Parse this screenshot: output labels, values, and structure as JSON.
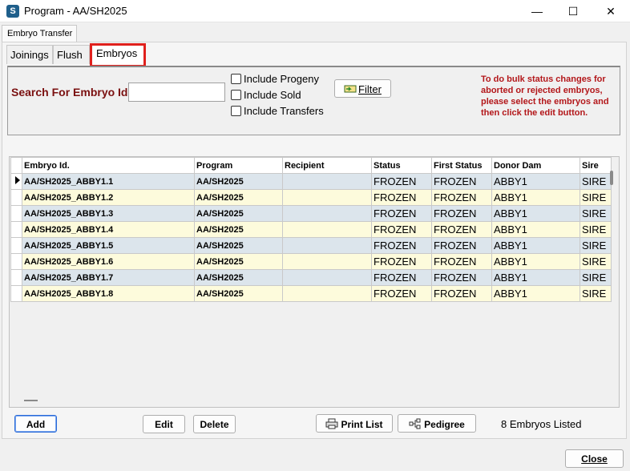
{
  "window": {
    "title": "Program - AA/SH2025",
    "app_icon": "S",
    "minimize": "—",
    "maximize": "☐",
    "close": "✕"
  },
  "outer_tab": {
    "label": "Embryo Transfer"
  },
  "tabs": [
    {
      "label": "Joinings"
    },
    {
      "label": "Flush"
    },
    {
      "label": "Embryos",
      "selected": true
    }
  ],
  "search": {
    "label": "Search For Embryo Id.",
    "value": "",
    "options": [
      {
        "label": "Include Progeny",
        "checked": false
      },
      {
        "label": "Include Sold",
        "checked": false
      },
      {
        "label": "Include Transfers",
        "checked": false
      }
    ],
    "filter_button": {
      "icon": "filter-icon",
      "label": "Filter"
    }
  },
  "bulk_note": "To do bulk status changes for aborted or rejected embryos, please select the embryos and then click the edit button.",
  "grid": {
    "columns": [
      "Embryo Id.",
      "Program",
      "Recipient",
      "Status",
      "First Status",
      "Donor Dam",
      "Sire"
    ],
    "rows": [
      {
        "embryo_id": "AA/SH2025_ABBY1.1",
        "program": "AA/SH2025",
        "recipient": "",
        "status": "FROZEN",
        "first_status": "FROZEN",
        "donor_dam": "ABBY1",
        "sire": "SIRE"
      },
      {
        "embryo_id": "AA/SH2025_ABBY1.2",
        "program": "AA/SH2025",
        "recipient": "",
        "status": "FROZEN",
        "first_status": "FROZEN",
        "donor_dam": "ABBY1",
        "sire": "SIRE"
      },
      {
        "embryo_id": "AA/SH2025_ABBY1.3",
        "program": "AA/SH2025",
        "recipient": "",
        "status": "FROZEN",
        "first_status": "FROZEN",
        "donor_dam": "ABBY1",
        "sire": "SIRE"
      },
      {
        "embryo_id": "AA/SH2025_ABBY1.4",
        "program": "AA/SH2025",
        "recipient": "",
        "status": "FROZEN",
        "first_status": "FROZEN",
        "donor_dam": "ABBY1",
        "sire": "SIRE"
      },
      {
        "embryo_id": "AA/SH2025_ABBY1.5",
        "program": "AA/SH2025",
        "recipient": "",
        "status": "FROZEN",
        "first_status": "FROZEN",
        "donor_dam": "ABBY1",
        "sire": "SIRE"
      },
      {
        "embryo_id": "AA/SH2025_ABBY1.6",
        "program": "AA/SH2025",
        "recipient": "",
        "status": "FROZEN",
        "first_status": "FROZEN",
        "donor_dam": "ABBY1",
        "sire": "SIRE"
      },
      {
        "embryo_id": "AA/SH2025_ABBY1.7",
        "program": "AA/SH2025",
        "recipient": "",
        "status": "FROZEN",
        "first_status": "FROZEN",
        "donor_dam": "ABBY1",
        "sire": "SIRE"
      },
      {
        "embryo_id": "AA/SH2025_ABBY1.8",
        "program": "AA/SH2025",
        "recipient": "",
        "status": "FROZEN",
        "first_status": "FROZEN",
        "donor_dam": "ABBY1",
        "sire": "SIRE"
      }
    ]
  },
  "buttons": {
    "add": "Add",
    "edit": "Edit",
    "delete": "Delete",
    "print_list": {
      "icon": "printer-icon",
      "label": "Print List"
    },
    "pedigree": {
      "icon": "pedigree-icon",
      "label": "Pedigree"
    },
    "close": "Close"
  },
  "status_text": "8 Embryos Listed",
  "colors": {
    "highlight_border": "#e0201c",
    "label_dark_red": "#7a1010",
    "note_red": "#b3171a",
    "row_blue": "#dce5ec",
    "row_yellow": "#fdfbdc"
  }
}
